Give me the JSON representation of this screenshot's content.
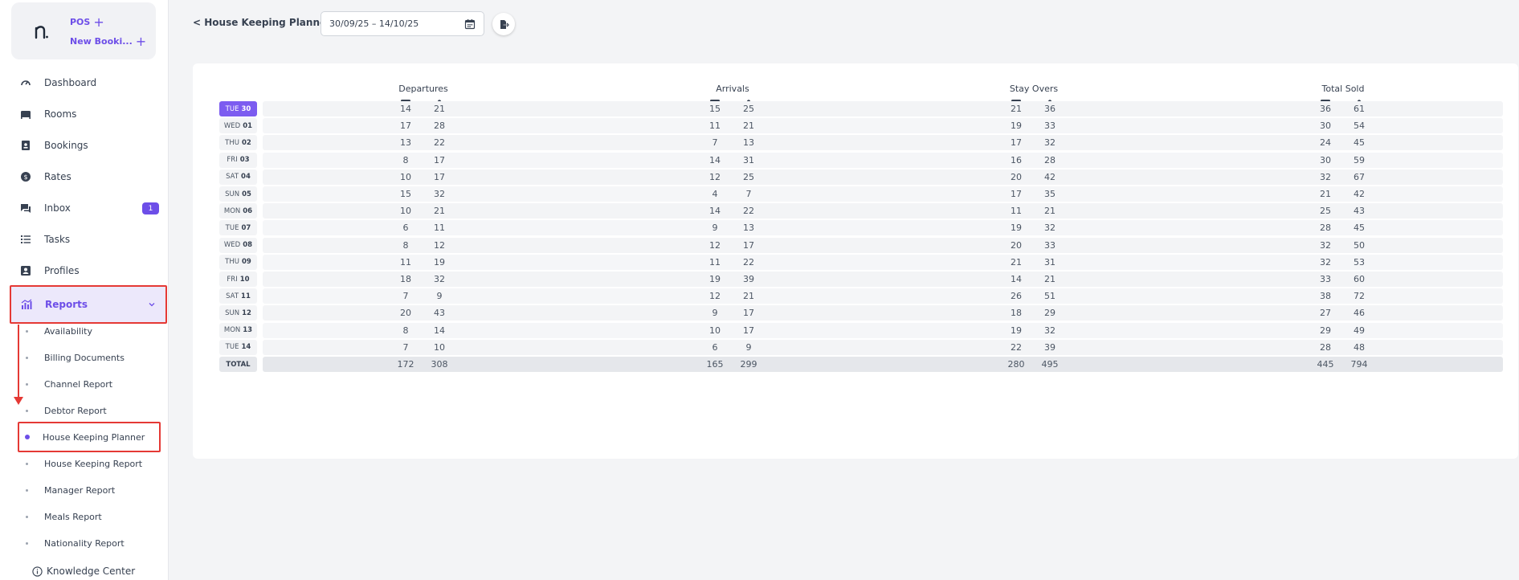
{
  "sidebar": {
    "quick_actions": {
      "pos": "POS",
      "new_booking": "New Booki..."
    },
    "nav": [
      {
        "label": "Dashboard",
        "icon": "dashboard-icon"
      },
      {
        "label": "Rooms",
        "icon": "bed-icon"
      },
      {
        "label": "Bookings",
        "icon": "bookings-icon"
      },
      {
        "label": "Rates",
        "icon": "rates-icon"
      },
      {
        "label": "Inbox",
        "icon": "inbox-icon",
        "badge": "1"
      },
      {
        "label": "Tasks",
        "icon": "tasks-icon"
      },
      {
        "label": "Profiles",
        "icon": "profile-icon"
      }
    ],
    "reports": {
      "label": "Reports",
      "icon": "reports-chart-icon"
    },
    "report_items": [
      "Availability",
      "Billing Documents",
      "Channel Report",
      "Debtor Report",
      "House Keeping Planner",
      "House Keeping Report",
      "Manager Report",
      "Meals Report",
      "Nationality Report"
    ],
    "knowledge_center": "Knowledge Center"
  },
  "header": {
    "back_label": "< House Keeping Planner",
    "date_range": "30/09/25 – 14/10/25"
  },
  "table": {
    "groups": [
      "Departures",
      "Arrivals",
      "Stay Overs",
      "Total Sold"
    ],
    "rows": [
      {
        "dow": "TUE",
        "day": "30",
        "today": true,
        "values": [
          "14",
          "21",
          "15",
          "25",
          "21",
          "36",
          "36",
          "61"
        ]
      },
      {
        "dow": "WED",
        "day": "01",
        "values": [
          "17",
          "28",
          "11",
          "21",
          "19",
          "33",
          "30",
          "54"
        ]
      },
      {
        "dow": "THU",
        "day": "02",
        "values": [
          "13",
          "22",
          "7",
          "13",
          "17",
          "32",
          "24",
          "45"
        ]
      },
      {
        "dow": "FRI",
        "day": "03",
        "values": [
          "8",
          "17",
          "14",
          "31",
          "16",
          "28",
          "30",
          "59"
        ]
      },
      {
        "dow": "SAT",
        "day": "04",
        "values": [
          "10",
          "17",
          "12",
          "25",
          "20",
          "42",
          "32",
          "67"
        ]
      },
      {
        "dow": "SUN",
        "day": "05",
        "values": [
          "15",
          "32",
          "4",
          "7",
          "17",
          "35",
          "21",
          "42"
        ]
      },
      {
        "dow": "MON",
        "day": "06",
        "values": [
          "10",
          "21",
          "14",
          "22",
          "11",
          "21",
          "25",
          "43"
        ]
      },
      {
        "dow": "TUE",
        "day": "07",
        "values": [
          "6",
          "11",
          "9",
          "13",
          "19",
          "32",
          "28",
          "45"
        ]
      },
      {
        "dow": "WED",
        "day": "08",
        "values": [
          "8",
          "12",
          "12",
          "17",
          "20",
          "33",
          "32",
          "50"
        ]
      },
      {
        "dow": "THU",
        "day": "09",
        "values": [
          "11",
          "19",
          "11",
          "22",
          "21",
          "31",
          "32",
          "53"
        ]
      },
      {
        "dow": "FRI",
        "day": "10",
        "values": [
          "18",
          "32",
          "19",
          "39",
          "14",
          "21",
          "33",
          "60"
        ]
      },
      {
        "dow": "SAT",
        "day": "11",
        "values": [
          "7",
          "9",
          "12",
          "21",
          "26",
          "51",
          "38",
          "72"
        ]
      },
      {
        "dow": "SUN",
        "day": "12",
        "values": [
          "20",
          "43",
          "9",
          "17",
          "18",
          "29",
          "27",
          "46"
        ]
      },
      {
        "dow": "MON",
        "day": "13",
        "values": [
          "8",
          "14",
          "10",
          "17",
          "19",
          "32",
          "29",
          "49"
        ]
      },
      {
        "dow": "TUE",
        "day": "14",
        "values": [
          "7",
          "10",
          "6",
          "9",
          "22",
          "39",
          "28",
          "48"
        ]
      }
    ],
    "total": {
      "label": "TOTAL",
      "values": [
        "172",
        "308",
        "165",
        "299",
        "280",
        "495",
        "445",
        "794"
      ]
    }
  },
  "colors": {
    "accent": "#6d4ee8",
    "highlight_border": "#e53935"
  }
}
